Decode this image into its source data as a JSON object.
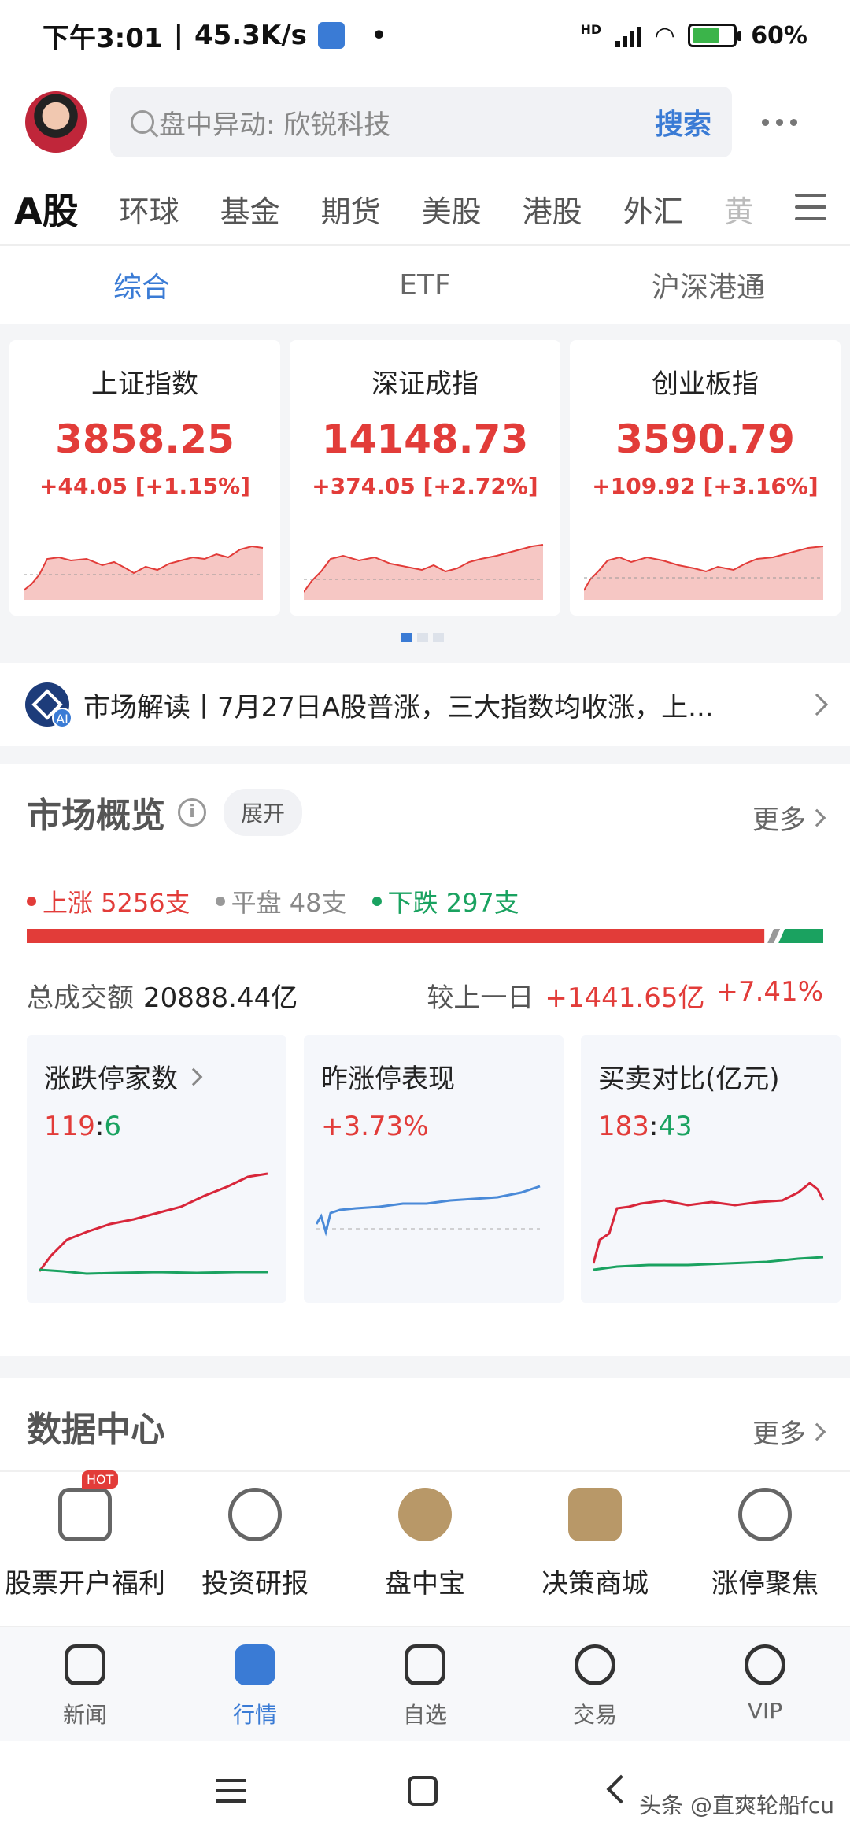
{
  "status_bar": {
    "time": "下午3:01",
    "speed": "45.3K/s",
    "dot": "•",
    "battery": "60%",
    "signal_label": "HD"
  },
  "header": {
    "search_placeholder": "盘中异动: 欣锐科技",
    "search_button": "搜索"
  },
  "market_tabs": [
    "A股",
    "环球",
    "基金",
    "期货",
    "美股",
    "港股",
    "外汇",
    "黄"
  ],
  "sub_tabs": [
    "综合",
    "ETF",
    "沪深港通"
  ],
  "indices": [
    {
      "name": "上证指数",
      "value": "3858.25",
      "change": "+44.05 [+1.15%]"
    },
    {
      "name": "深证成指",
      "value": "14148.73",
      "change": "+374.05 [+2.72%]"
    },
    {
      "name": "创业板指",
      "value": "3590.79",
      "change": "+109.92 [+3.16%]"
    }
  ],
  "market_read": {
    "text": "市场解读丨7月27日A股普涨，三大指数均收涨，上..."
  },
  "overview": {
    "title": "市场概览",
    "info": "i",
    "expand": "展开",
    "more": "更多",
    "rise": "上涨 5256支",
    "flat": "平盘 48支",
    "fall": "下跌 297支",
    "rise_share": 0.93,
    "turnover_label": "总成交额",
    "turnover_value": "20888.44亿",
    "compare_label": "较上一日",
    "compare_value": "+1441.65亿",
    "compare_pct": "+7.41%",
    "cards": [
      {
        "title": "涨跌停家数",
        "a": "119",
        "sep": ":",
        "b": "6"
      },
      {
        "title": "昨涨停表现",
        "a": "+3.73%"
      },
      {
        "title": "买卖对比(亿元)",
        "a": "183",
        "sep": ":",
        "b": "43"
      }
    ]
  },
  "data_center": {
    "title": "数据中心",
    "more": "更多",
    "items": [
      {
        "label": "股票开户福利",
        "badge": "HOT"
      },
      {
        "label": "投资研报"
      },
      {
        "label": "盘中宝"
      },
      {
        "label": "决策商城"
      },
      {
        "label": "涨停聚焦"
      }
    ]
  },
  "bottom_nav": [
    "新闻",
    "行情",
    "自选",
    "交易",
    "VIP"
  ],
  "watermark": "头条 @直爽轮船fcu",
  "colors": {
    "red": "#e23c39",
    "green": "#1aa260",
    "blue": "#3a7bd5"
  }
}
